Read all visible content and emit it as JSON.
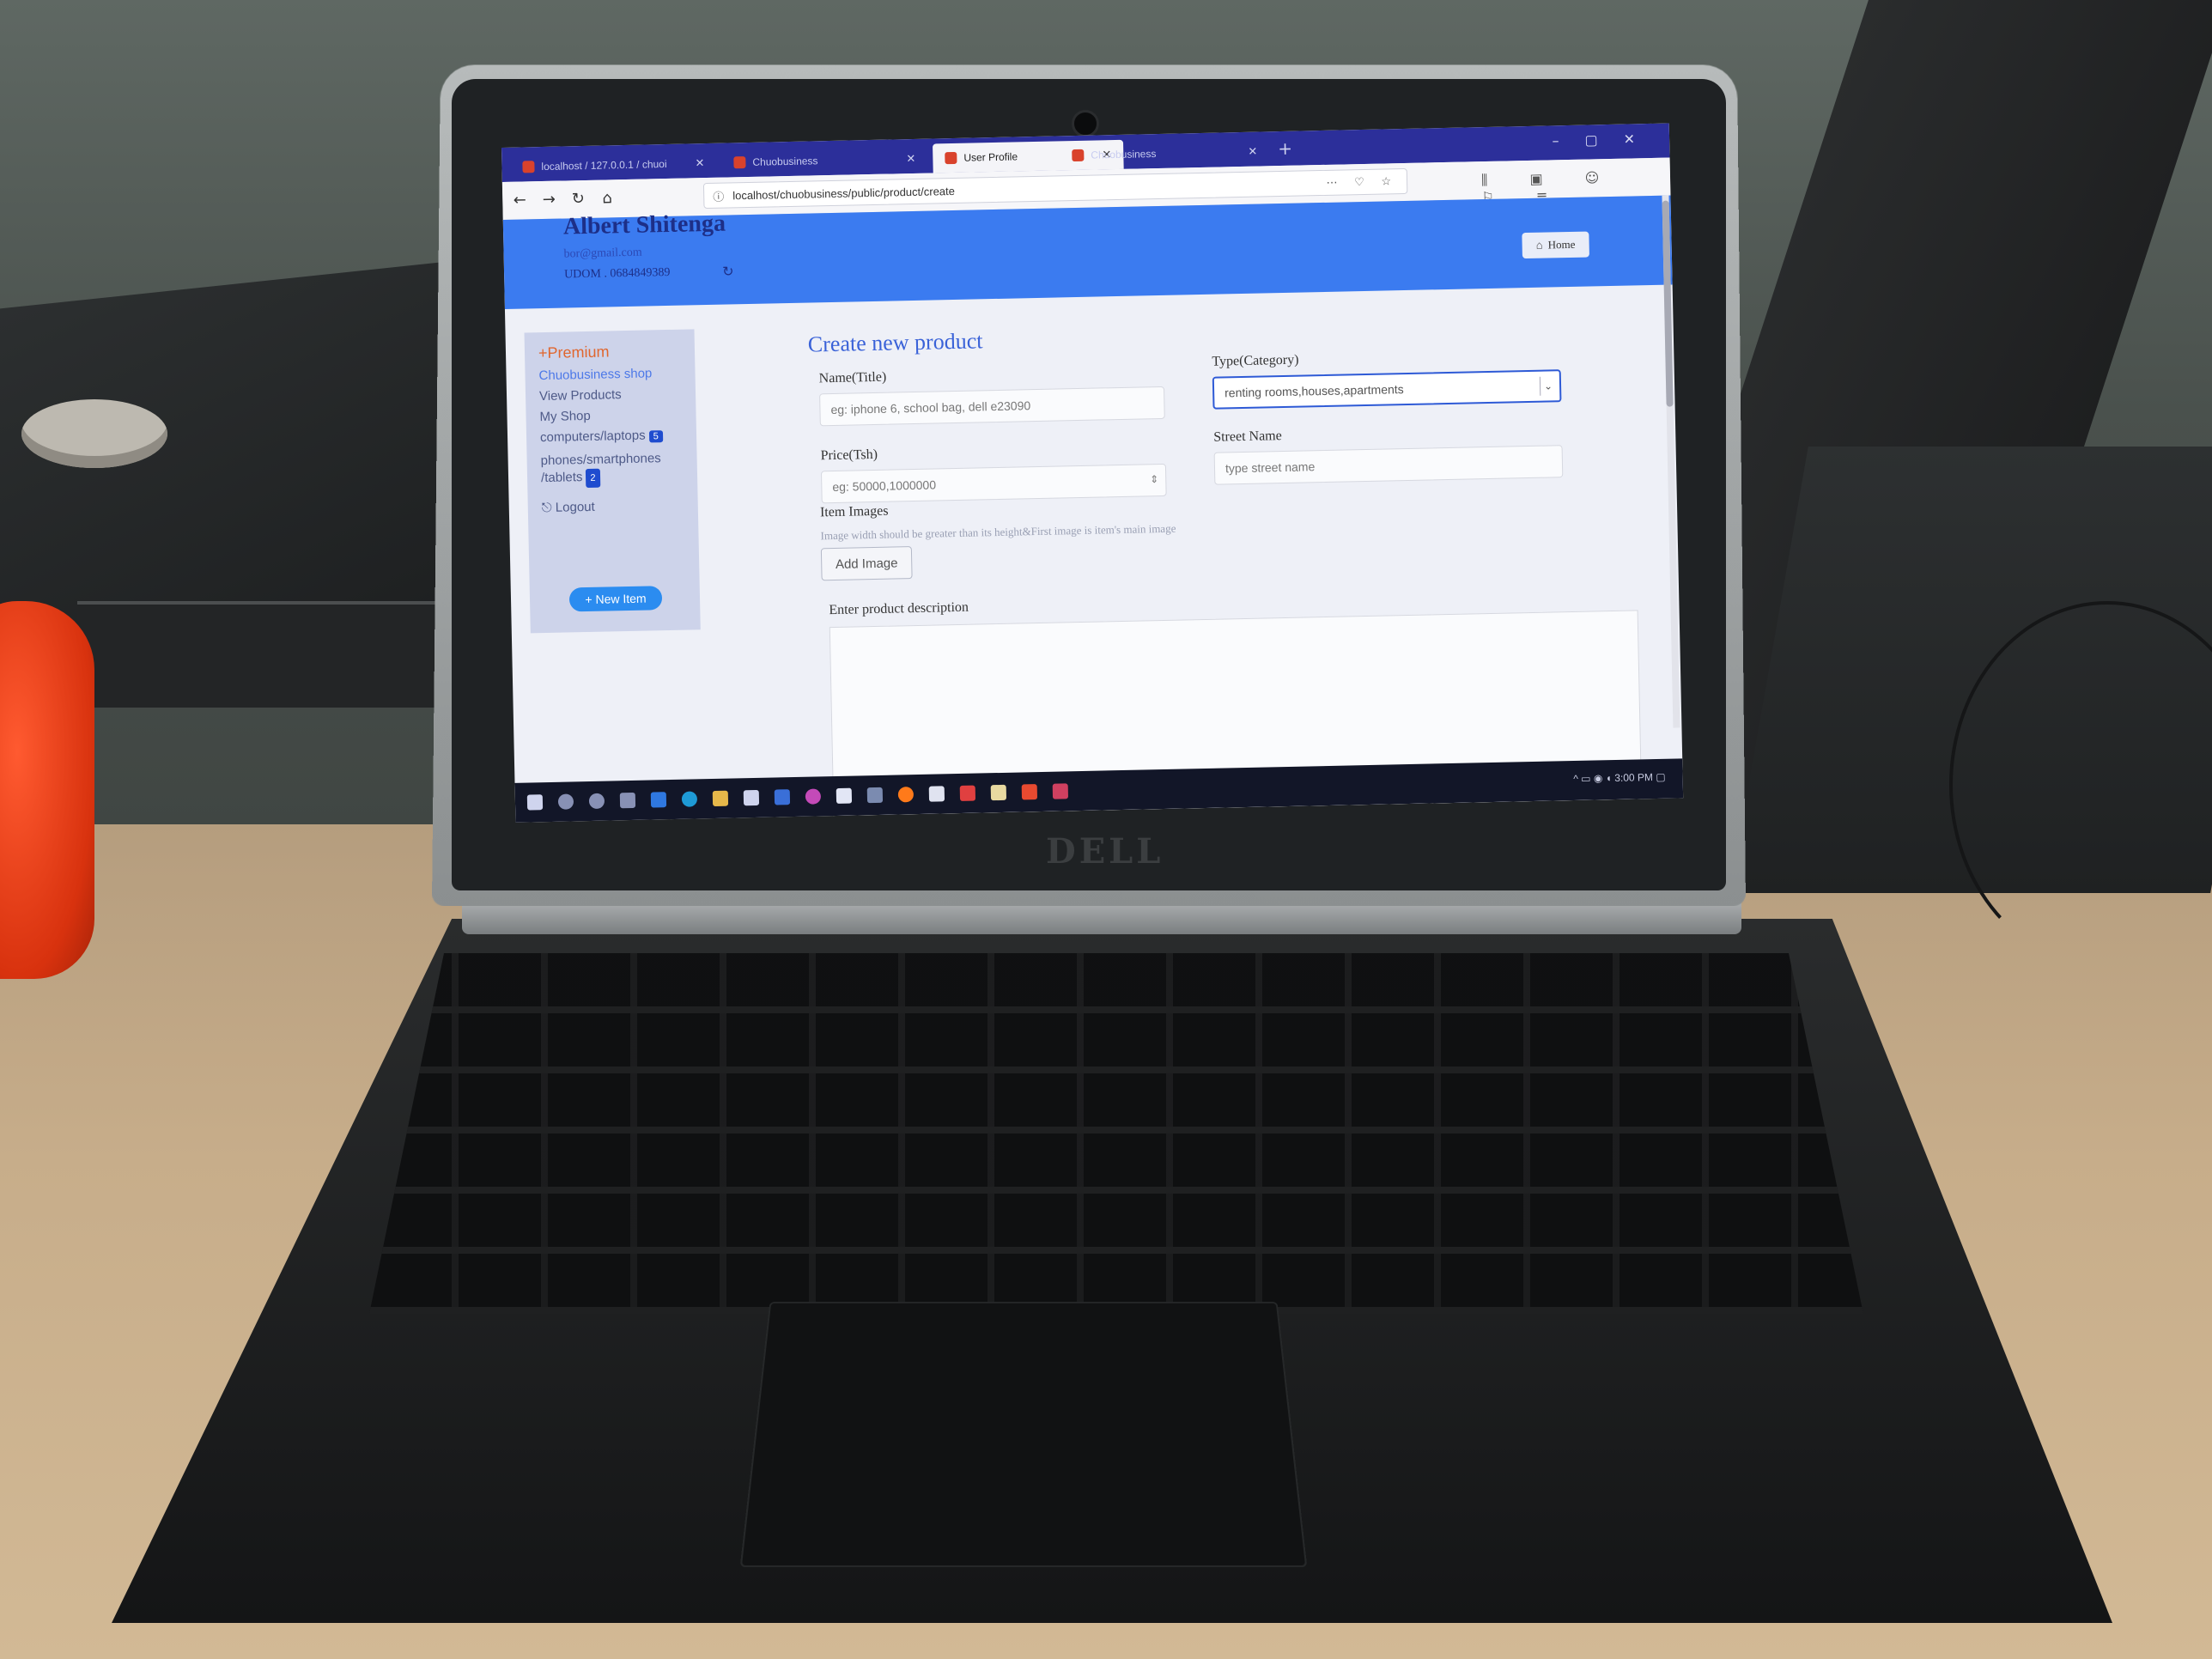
{
  "browser": {
    "tabs": [
      {
        "label": "localhost / 127.0.0.1 / chuoi"
      },
      {
        "label": "Chuobusiness"
      },
      {
        "label": "User Profile",
        "active": true
      },
      {
        "label": "Chuobusiness"
      }
    ],
    "url": "localhost/chuobusiness/public/product/create"
  },
  "header": {
    "user_name": "Albert Shitenga",
    "email": "bor@gmail.com",
    "phone": "UDOM . 0684849389",
    "home_label": "Home"
  },
  "sidebar": {
    "items": [
      {
        "label": "+Premium"
      },
      {
        "label": "Chuobusiness shop"
      },
      {
        "label": "View Products"
      },
      {
        "label": "My Shop"
      },
      {
        "label": "computers/laptops",
        "badge": "5"
      },
      {
        "label": "phones/smartphones /tablets",
        "badge": "2"
      },
      {
        "label": "Logout"
      }
    ],
    "new_item_label": "+ New Item"
  },
  "form": {
    "title": "Create new product",
    "name_label": "Name(Title)",
    "name_placeholder": "eg: iphone 6, school bag, dell e23090",
    "type_label": "Type(Category)",
    "type_value": "renting rooms,houses,apartments",
    "price_label": "Price(Tsh)",
    "price_placeholder": "eg: 50000,1000000",
    "street_label": "Street Name",
    "street_placeholder": "type street name",
    "images_label": "Item Images",
    "images_hint": "Image width should be greater than its height&First image is item's main image",
    "add_image_label": "Add Image",
    "description_label": "Enter product description"
  },
  "taskbar": {
    "time": "3:00 PM"
  },
  "colors": {
    "header_blue": "#3b7bf0",
    "tab_bar": "#2c2f9a",
    "accent": "#3a62d8",
    "premium": "#e0662e"
  }
}
